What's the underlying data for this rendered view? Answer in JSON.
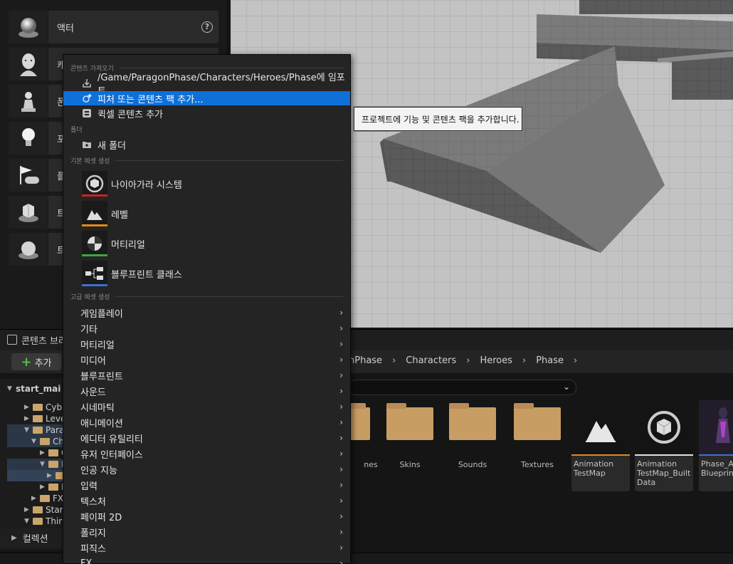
{
  "place_panel": {
    "items": [
      {
        "label": "액터",
        "icon": "sphere-icon"
      },
      {
        "label": "캐",
        "icon": "character-icon"
      },
      {
        "label": "폰",
        "icon": "pawn-icon"
      },
      {
        "label": "포",
        "icon": "point-light-icon"
      },
      {
        "label": "플",
        "icon": "player-start-icon"
      },
      {
        "label": "트",
        "icon": "trigger-box-icon"
      },
      {
        "label": "트",
        "icon": "trigger-sphere-icon"
      }
    ]
  },
  "context_menu": {
    "sections": {
      "import": "콘텐츠 가져오기",
      "folder": "폴더",
      "basic": "기본 에셋 생성",
      "advanced": "고급 에셋 생성"
    },
    "import_items": [
      {
        "label": "/Game/ParagonPhase/Characters/Heroes/Phase에 임포트...",
        "icon": "import-icon"
      },
      {
        "label": "피처 또는 콘텐츠 팩 추가...",
        "icon": "add-feature-pack-icon",
        "highlighted": true
      },
      {
        "label": "퀵셀 콘텐츠 추가",
        "icon": "quixel-icon"
      }
    ],
    "folder_items": [
      {
        "label": "새 폴더",
        "icon": "new-folder-icon"
      }
    ],
    "basic_assets": [
      {
        "label": "나이아가라 시스템",
        "icon": "niagara-system-icon",
        "color": "#d12020"
      },
      {
        "label": "레벨",
        "icon": "level-icon",
        "color": "#e08a17"
      },
      {
        "label": "머티리얼",
        "icon": "material-icon",
        "color": "#3aa83a"
      },
      {
        "label": "블루프린트 클래스",
        "icon": "blueprint-class-icon",
        "color": "#3c6fd6"
      }
    ],
    "advanced_items": [
      "게임플레이",
      "기타",
      "머티리얼",
      "미디어",
      "블루프린트",
      "사운드",
      "시네마틱",
      "애니메이션",
      "에디터 유틸리티",
      "유저 인터페이스",
      "인공 지능",
      "입력",
      "텍스처",
      "페이퍼 2D",
      "폴리지",
      "피직스",
      "FX"
    ]
  },
  "tooltip": "프로젝트에 기능 및 콘텐츠 팩을 추가합니다.",
  "content_browser": {
    "title": "콘텐츠 브라",
    "add_label": "추가",
    "breadcrumb": [
      "nPhase",
      "Characters",
      "Heroes",
      "Phase"
    ],
    "sources": {
      "root": "start_mai",
      "rows": [
        "Cyb",
        "Leve",
        "Para",
        "Ch",
        "C",
        "H",
        "",
        "M",
        "FX",
        "Star",
        "Thir"
      ]
    },
    "collections_label": "컬렉션",
    "folders": [
      "nes",
      "Skins",
      "Sounds",
      "Textures"
    ],
    "assets": [
      {
        "name": "Animation TestMap",
        "color": "#e08a17",
        "icon": "level-icon"
      },
      {
        "name": "Animation TestMap_Built Data",
        "color": "#e0e0e0",
        "icon": "map-build-data-icon"
      },
      {
        "name": "Phase_A Blueprint",
        "color": "#3c6fd6",
        "icon": "character-thumbnail"
      }
    ]
  },
  "colors": {
    "highlight": "#0e70d8",
    "folder": "#c89d63"
  }
}
